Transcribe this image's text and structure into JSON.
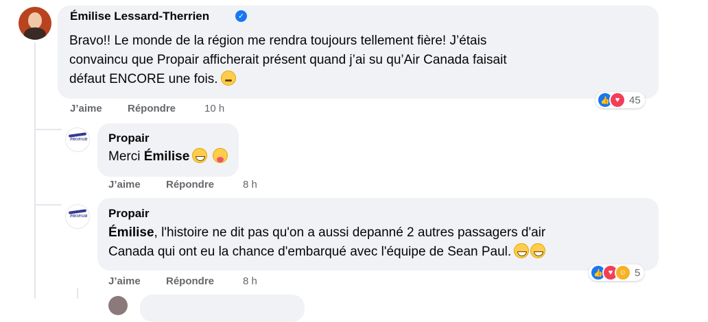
{
  "comments": [
    {
      "author": "Émilise Lessard-Therrien",
      "verified": true,
      "lines": [
        "Bravo!! Le monde de la région me rendra toujours tellement fière! J’étais",
        "convaincu que Propair afficherait présent quand j’ai su qu’Air Canada faisait",
        "défaut ENCORE une fois."
      ],
      "like_label": "J’aime",
      "reply_label": "Répondre",
      "time": "10 h",
      "reaction_count": "45",
      "reaction_icons": [
        "like-icon",
        "love-icon"
      ]
    },
    {
      "author": "Propair",
      "text": "Merci ",
      "mention": "Émilise",
      "like_label": "J’aime",
      "reply_label": "Répondre",
      "time": "8 h"
    },
    {
      "author": "Propair",
      "mention": "Émilise",
      "line1_rest": ", l'histoire ne dit pas qu'on a aussi depanné 2 autres passagers d'air",
      "line2": "Canada qui ont eu la chance d'embarqué avec l'équipe de Sean Paul.",
      "like_label": "J’aime",
      "reply_label": "Répondre",
      "time": "8 h",
      "reaction_count": "5",
      "reaction_icons": [
        "like-icon",
        "love-icon",
        "care-icon"
      ]
    }
  ],
  "logo_text": "PROPAIR",
  "colors": {
    "bubble": "#f0f2f5",
    "meta": "#65676b",
    "like": "#1877f2",
    "love": "#f33e58"
  }
}
